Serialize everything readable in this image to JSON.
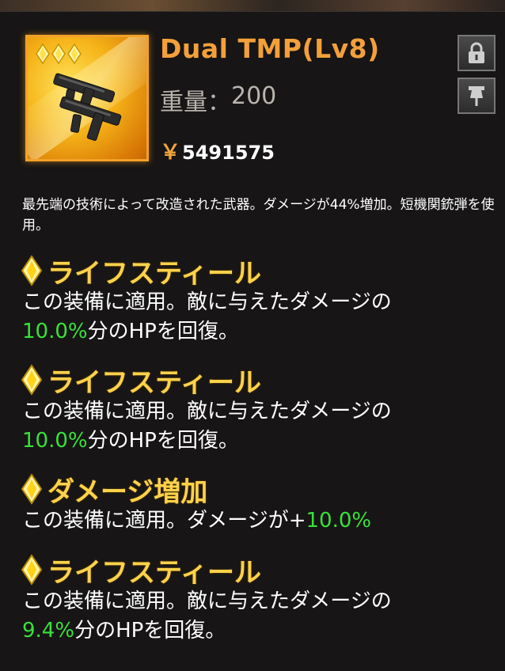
{
  "item": {
    "title": "Dual TMP(Lv8)",
    "weight_label": "重量：",
    "weight_value": "200",
    "currency_symbol": "￥",
    "price": "5491575",
    "rarity_stars": 3,
    "description": "最先端の技術によって改造された武器。ダメージが44%増加。短機関銃弾を使用。"
  },
  "buttons": {
    "lock_icon": "lock-icon",
    "pin_icon": "pin-icon"
  },
  "skills": [
    {
      "name": "ライフスティール",
      "text_prefix": "この装備に適用。敵に与えたダメージの",
      "value": "10.0%",
      "text_suffix": "分のHPを回復。"
    },
    {
      "name": "ライフスティール",
      "text_prefix": "この装備に適用。敵に与えたダメージの",
      "value": "10.0%",
      "text_suffix": "分のHPを回復。"
    },
    {
      "name": "ダメージ増加",
      "text_prefix": "この装備に適用。ダメージが+",
      "value": "10.0%",
      "text_suffix": ""
    },
    {
      "name": "ライフスティール",
      "text_prefix": "この装備に適用。敵に与えたダメージの",
      "value": "9.4%",
      "text_suffix": "分のHPを回復。"
    }
  ],
  "colors": {
    "title": "#f3a03a",
    "skill_name": "#ffd24a",
    "value_green": "#37e23a",
    "icon_frame": "#f2a12a"
  }
}
